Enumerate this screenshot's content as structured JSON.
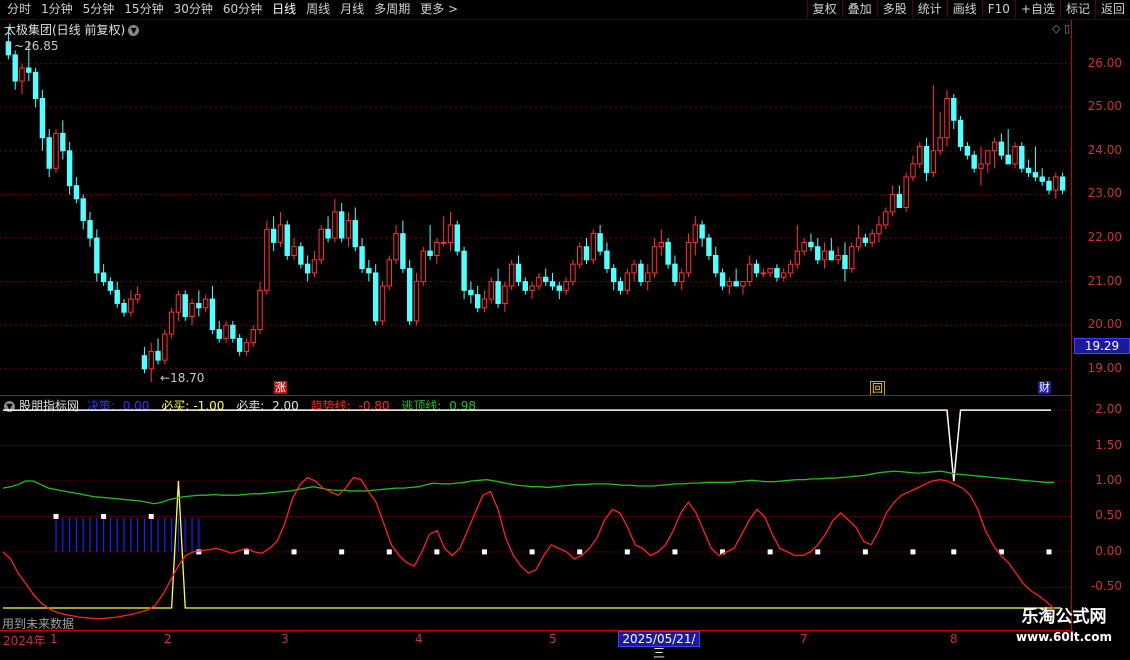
{
  "toolbar": {
    "periods": [
      "分时",
      "1分钟",
      "5分钟",
      "15分钟",
      "30分钟",
      "60分钟",
      "日线",
      "周线",
      "月线",
      "多周期",
      "更多 >"
    ],
    "active_period": "日线",
    "buttons": [
      "复权",
      "叠加",
      "多股",
      "统计",
      "画线",
      "F10",
      "+自选",
      "标记",
      "返回"
    ]
  },
  "stock": {
    "title": "太极集团(日线 前复权)",
    "high_label": "26.85",
    "low_label": "18.70",
    "current_price": "19.29"
  },
  "price_axis": {
    "labels": [
      "26.00",
      "25.00",
      "24.00",
      "23.00",
      "22.00",
      "21.00",
      "20.00",
      "19.00"
    ]
  },
  "markers": {
    "zhang": "涨",
    "hui": "回",
    "cai": "财"
  },
  "indicator": {
    "name": "股朋指标网",
    "juece_label": "决策:",
    "juece_value": "0.00",
    "bimai_label": "必买:",
    "bimai_value": "-1.00",
    "bimaic_label": "必卖:",
    "bimaic_value": "2.00",
    "trend_label": "趋势线:",
    "trend_value": "-0.80",
    "escape_label": "逃顶线:",
    "escape_value": "0.98",
    "axis_labels": [
      "2.00",
      "1.50",
      "1.00",
      "0.50",
      "0.00",
      "-0.50"
    ],
    "future_note": "用到未来数据"
  },
  "xaxis": {
    "year": "2024年",
    "months": [
      "1",
      "2",
      "3",
      "4",
      "5",
      "7",
      "8"
    ],
    "cursor_date": "2025/05/21/三"
  },
  "watermark": {
    "line1": "乐淘公式网",
    "line2": "www.60lt.com"
  },
  "colors": {
    "up": "#ff3232",
    "down": "#54ffff",
    "trend": "#ff2020",
    "escape": "#20c020",
    "white": "#ffffff",
    "yellow": "#ffff40",
    "blue": "#2020ff"
  },
  "chart_data": {
    "type": "candlestick",
    "price_ylim": [
      18.4,
      27.0
    ],
    "candles": [
      [
        26.5,
        26.85,
        26.1,
        26.2
      ],
      [
        26.2,
        26.3,
        25.4,
        25.6
      ],
      [
        25.6,
        26.0,
        25.3,
        25.9
      ],
      [
        25.9,
        26.5,
        25.6,
        25.8
      ],
      [
        25.8,
        25.9,
        25.0,
        25.2
      ],
      [
        25.2,
        25.4,
        24.0,
        24.3
      ],
      [
        24.3,
        24.5,
        23.4,
        23.6
      ],
      [
        23.6,
        24.5,
        23.5,
        24.4
      ],
      [
        24.4,
        24.7,
        23.8,
        24.0
      ],
      [
        24.0,
        24.2,
        23.0,
        23.2
      ],
      [
        23.2,
        23.4,
        22.8,
        22.9
      ],
      [
        22.9,
        23.0,
        22.2,
        22.4
      ],
      [
        22.4,
        22.6,
        21.8,
        22.0
      ],
      [
        22.0,
        22.2,
        21.0,
        21.2
      ],
      [
        21.2,
        21.4,
        20.9,
        21.0
      ],
      [
        21.0,
        21.1,
        20.7,
        20.8
      ],
      [
        20.8,
        21.0,
        20.4,
        20.5
      ],
      [
        20.5,
        20.6,
        20.2,
        20.3
      ],
      [
        20.3,
        20.8,
        20.2,
        20.6
      ],
      [
        20.6,
        20.9,
        20.5,
        20.7
      ],
      [
        19.3,
        19.5,
        18.9,
        19.0
      ],
      [
        19.0,
        19.6,
        18.7,
        19.4
      ],
      [
        19.4,
        19.7,
        19.1,
        19.2
      ],
      [
        19.2,
        19.9,
        19.1,
        19.8
      ],
      [
        19.8,
        20.4,
        19.7,
        20.3
      ],
      [
        20.3,
        20.8,
        20.1,
        20.7
      ],
      [
        20.7,
        20.8,
        20.1,
        20.2
      ],
      [
        20.2,
        20.6,
        20.0,
        20.5
      ],
      [
        20.5,
        20.8,
        20.2,
        20.4
      ],
      [
        20.4,
        20.7,
        20.3,
        20.6
      ],
      [
        20.6,
        20.9,
        19.8,
        19.9
      ],
      [
        19.9,
        20.1,
        19.6,
        19.7
      ],
      [
        19.7,
        20.1,
        19.6,
        20.0
      ],
      [
        20.0,
        20.1,
        19.6,
        19.7
      ],
      [
        19.7,
        19.8,
        19.3,
        19.4
      ],
      [
        19.4,
        19.7,
        19.3,
        19.6
      ],
      [
        19.6,
        20.0,
        19.5,
        19.9
      ],
      [
        19.9,
        21.0,
        19.8,
        20.8
      ],
      [
        20.8,
        22.4,
        20.7,
        22.2
      ],
      [
        22.2,
        22.5,
        21.7,
        21.9
      ],
      [
        21.9,
        22.6,
        21.8,
        22.3
      ],
      [
        22.3,
        22.4,
        21.5,
        21.6
      ],
      [
        21.6,
        22.0,
        21.5,
        21.8
      ],
      [
        21.8,
        21.9,
        21.3,
        21.4
      ],
      [
        21.4,
        21.6,
        21.0,
        21.2
      ],
      [
        21.2,
        21.7,
        21.1,
        21.5
      ],
      [
        21.5,
        22.3,
        21.4,
        22.2
      ],
      [
        22.2,
        22.5,
        21.9,
        22.0
      ],
      [
        22.0,
        22.9,
        21.9,
        22.6
      ],
      [
        22.6,
        22.8,
        21.9,
        22.0
      ],
      [
        22.0,
        22.6,
        21.8,
        22.4
      ],
      [
        22.4,
        22.7,
        21.7,
        21.8
      ],
      [
        21.8,
        22.0,
        21.2,
        21.3
      ],
      [
        21.3,
        21.5,
        21.0,
        21.2
      ],
      [
        21.2,
        21.4,
        20.0,
        20.1
      ],
      [
        20.1,
        21.0,
        20.0,
        20.9
      ],
      [
        20.9,
        21.6,
        20.8,
        21.5
      ],
      [
        21.5,
        22.3,
        21.4,
        22.1
      ],
      [
        22.1,
        22.4,
        21.2,
        21.3
      ],
      [
        21.3,
        21.5,
        20.0,
        20.1
      ],
      [
        20.1,
        21.2,
        20.0,
        21.0
      ],
      [
        21.0,
        21.8,
        20.9,
        21.7
      ],
      [
        21.7,
        22.3,
        21.5,
        21.6
      ],
      [
        21.6,
        22.0,
        21.4,
        21.9
      ],
      [
        21.9,
        22.5,
        21.8,
        21.9
      ],
      [
        21.9,
        22.6,
        21.7,
        22.3
      ],
      [
        22.3,
        22.4,
        21.6,
        21.7
      ],
      [
        21.7,
        21.8,
        20.6,
        20.8
      ],
      [
        20.8,
        21.0,
        20.5,
        20.7
      ],
      [
        20.7,
        20.9,
        20.3,
        20.4
      ],
      [
        20.4,
        20.8,
        20.3,
        20.6
      ],
      [
        20.6,
        21.1,
        20.5,
        21.0
      ],
      [
        21.0,
        21.3,
        20.4,
        20.5
      ],
      [
        20.5,
        21.0,
        20.3,
        20.9
      ],
      [
        20.9,
        21.5,
        20.8,
        21.4
      ],
      [
        21.4,
        21.6,
        20.9,
        21.0
      ],
      [
        21.0,
        21.1,
        20.7,
        20.8
      ],
      [
        20.8,
        21.0,
        20.6,
        20.9
      ],
      [
        20.9,
        21.2,
        20.8,
        21.1
      ],
      [
        21.1,
        21.3,
        20.9,
        21.0
      ],
      [
        21.0,
        21.2,
        20.8,
        20.9
      ],
      [
        20.9,
        21.0,
        20.6,
        20.8
      ],
      [
        20.8,
        21.1,
        20.7,
        21.0
      ],
      [
        21.0,
        21.5,
        20.9,
        21.4
      ],
      [
        21.4,
        21.9,
        21.3,
        21.8
      ],
      [
        21.8,
        22.0,
        21.4,
        21.5
      ],
      [
        21.5,
        22.2,
        21.4,
        22.1
      ],
      [
        22.1,
        22.3,
        21.6,
        21.7
      ],
      [
        21.7,
        21.9,
        21.2,
        21.3
      ],
      [
        21.3,
        21.4,
        20.8,
        21.0
      ],
      [
        21.0,
        21.1,
        20.7,
        20.8
      ],
      [
        20.8,
        21.3,
        20.7,
        21.2
      ],
      [
        21.2,
        21.5,
        21.0,
        21.4
      ],
      [
        21.4,
        21.5,
        20.9,
        21.0
      ],
      [
        21.0,
        21.4,
        20.8,
        21.2
      ],
      [
        21.2,
        22.0,
        21.1,
        21.8
      ],
      [
        21.8,
        22.2,
        21.6,
        21.9
      ],
      [
        21.9,
        22.0,
        21.3,
        21.4
      ],
      [
        21.4,
        21.6,
        20.9,
        21.0
      ],
      [
        21.0,
        21.3,
        20.8,
        21.2
      ],
      [
        21.2,
        22.1,
        21.1,
        21.9
      ],
      [
        21.9,
        22.5,
        21.6,
        22.3
      ],
      [
        22.3,
        22.4,
        21.8,
        22.0
      ],
      [
        22.0,
        22.1,
        21.5,
        21.6
      ],
      [
        21.6,
        21.8,
        21.1,
        21.2
      ],
      [
        21.2,
        21.3,
        20.8,
        20.9
      ],
      [
        20.9,
        21.1,
        20.7,
        21.0
      ],
      [
        21.0,
        21.3,
        20.9,
        20.9
      ],
      [
        20.9,
        21.0,
        20.7,
        21.0
      ],
      [
        21.0,
        21.6,
        20.9,
        21.4
      ],
      [
        21.4,
        21.5,
        21.1,
        21.2
      ],
      [
        21.2,
        21.3,
        21.1,
        21.2
      ],
      [
        21.2,
        21.3,
        21.1,
        21.3
      ],
      [
        21.3,
        21.4,
        21.0,
        21.1
      ],
      [
        21.1,
        21.3,
        21.0,
        21.2
      ],
      [
        21.2,
        21.5,
        21.1,
        21.4
      ],
      [
        21.4,
        22.3,
        21.3,
        21.7
      ],
      [
        21.7,
        22.0,
        21.6,
        21.9
      ],
      [
        21.9,
        22.1,
        21.7,
        21.8
      ],
      [
        21.8,
        22.0,
        21.4,
        21.5
      ],
      [
        21.5,
        21.9,
        21.3,
        21.7
      ],
      [
        21.7,
        22.0,
        21.5,
        21.5
      ],
      [
        21.5,
        21.8,
        21.4,
        21.6
      ],
      [
        21.6,
        21.9,
        21.0,
        21.3
      ],
      [
        21.3,
        21.9,
        21.2,
        21.8
      ],
      [
        21.8,
        22.3,
        21.7,
        22.0
      ],
      [
        22.0,
        22.1,
        21.8,
        21.9
      ],
      [
        21.9,
        22.2,
        21.8,
        22.1
      ],
      [
        22.1,
        22.5,
        21.9,
        22.3
      ],
      [
        22.3,
        22.7,
        22.2,
        22.6
      ],
      [
        22.6,
        23.2,
        22.5,
        23.0
      ],
      [
        23.0,
        23.2,
        22.8,
        22.7
      ],
      [
        22.7,
        23.5,
        22.6,
        23.4
      ],
      [
        23.4,
        23.9,
        23.3,
        23.7
      ],
      [
        23.7,
        24.2,
        23.6,
        24.1
      ],
      [
        24.1,
        24.3,
        23.3,
        23.5
      ],
      [
        23.5,
        25.5,
        23.4,
        24.0
      ],
      [
        24.0,
        24.9,
        23.9,
        24.3
      ],
      [
        24.3,
        25.4,
        24.1,
        25.2
      ],
      [
        25.2,
        25.3,
        24.5,
        24.7
      ],
      [
        24.7,
        24.8,
        24.0,
        24.1
      ],
      [
        24.1,
        24.2,
        23.8,
        23.9
      ],
      [
        23.9,
        24.0,
        23.5,
        23.6
      ],
      [
        23.6,
        24.1,
        23.2,
        23.7
      ],
      [
        23.7,
        24.0,
        23.5,
        24.0
      ],
      [
        24.0,
        24.3,
        23.6,
        24.2
      ],
      [
        24.2,
        24.4,
        23.8,
        23.9
      ],
      [
        23.9,
        24.5,
        23.7,
        23.7
      ],
      [
        23.7,
        24.2,
        23.6,
        24.1
      ],
      [
        24.1,
        24.2,
        23.5,
        23.6
      ],
      [
        23.6,
        23.8,
        23.4,
        23.5
      ],
      [
        23.5,
        24.1,
        23.3,
        23.4
      ],
      [
        23.4,
        23.6,
        23.2,
        23.3
      ],
      [
        23.3,
        23.4,
        23.0,
        23.1
      ],
      [
        23.1,
        23.5,
        22.9,
        23.4
      ],
      [
        23.4,
        23.5,
        23.0,
        23.1
      ]
    ],
    "indicator_ylim": [
      -0.82,
      2.2
    ],
    "white_line": {
      "from": 0,
      "to": 1.5,
      "values": "2.00 constant with dip to 1.00 near index 139"
    },
    "trend_line": [
      -0.0,
      -0.1,
      -0.3,
      -0.45,
      -0.6,
      -0.72,
      -0.8,
      -0.85,
      -0.88,
      -0.9,
      -0.92,
      -0.93,
      -0.94,
      -0.94,
      -0.93,
      -0.92,
      -0.9,
      -0.88,
      -0.85,
      -0.82,
      -0.75,
      -0.6,
      -0.4,
      -0.2,
      -0.05,
      0.0,
      0.02,
      0.03,
      0.05,
      0.02,
      -0.02,
      0.02,
      0.05,
      0.0,
      -0.02,
      0.05,
      0.15,
      0.4,
      0.75,
      0.95,
      1.05,
      1.0,
      0.9,
      0.85,
      0.8,
      0.9,
      1.05,
      1.02,
      0.85,
      0.7,
      0.4,
      0.1,
      -0.05,
      -0.15,
      -0.2,
      0.0,
      0.25,
      0.3,
      0.05,
      -0.05,
      0.05,
      0.3,
      0.55,
      0.8,
      0.85,
      0.6,
      0.2,
      -0.05,
      -0.2,
      -0.3,
      -0.25,
      -0.05,
      0.1,
      0.05,
      0.0,
      -0.1,
      -0.05,
      0.05,
      0.2,
      0.45,
      0.6,
      0.55,
      0.35,
      0.1,
      0.05,
      -0.05,
      0.0,
      0.1,
      0.3,
      0.55,
      0.7,
      0.55,
      0.3,
      0.05,
      -0.05,
      0.0,
      0.05,
      0.25,
      0.45,
      0.6,
      0.5,
      0.25,
      0.05,
      0.0,
      -0.05,
      -0.05,
      0.0,
      0.1,
      0.25,
      0.45,
      0.55,
      0.45,
      0.35,
      0.15,
      0.1,
      0.3,
      0.55,
      0.7,
      0.8,
      0.85,
      0.9,
      0.95,
      1.0,
      1.02,
      1.0,
      0.95,
      0.9,
      0.8,
      0.6,
      0.3,
      0.1,
      -0.05,
      -0.15,
      -0.3,
      -0.45,
      -0.55,
      -0.62,
      -0.7,
      -0.8
    ],
    "escape_line": [
      0.9,
      0.92,
      0.95,
      1.0,
      1.0,
      0.95,
      0.9,
      0.88,
      0.86,
      0.84,
      0.82,
      0.8,
      0.78,
      0.77,
      0.76,
      0.75,
      0.74,
      0.73,
      0.72,
      0.7,
      0.68,
      0.7,
      0.74,
      0.76,
      0.78,
      0.79,
      0.8,
      0.8,
      0.81,
      0.8,
      0.8,
      0.8,
      0.81,
      0.82,
      0.82,
      0.83,
      0.84,
      0.85,
      0.86,
      0.88,
      0.9,
      0.92,
      0.9,
      0.88,
      0.87,
      0.87,
      0.86,
      0.86,
      0.86,
      0.87,
      0.88,
      0.89,
      0.9,
      0.9,
      0.91,
      0.92,
      0.95,
      0.97,
      0.96,
      0.96,
      0.97,
      0.98,
      1.0,
      1.01,
      1.02,
      1.0,
      0.98,
      0.96,
      0.94,
      0.93,
      0.92,
      0.92,
      0.91,
      0.92,
      0.93,
      0.94,
      0.95,
      0.95,
      0.96,
      0.96,
      0.96,
      0.95,
      0.94,
      0.94,
      0.93,
      0.93,
      0.93,
      0.94,
      0.95,
      0.96,
      0.96,
      0.97,
      0.97,
      0.98,
      0.98,
      0.98,
      0.98,
      0.99,
      1.0,
      1.01,
      1.0,
      0.99,
      0.99,
      1.0,
      1.01,
      1.02,
      1.02,
      1.03,
      1.03,
      1.04,
      1.04,
      1.05,
      1.06,
      1.07,
      1.08,
      1.1,
      1.12,
      1.13,
      1.14,
      1.13,
      1.12,
      1.11,
      1.12,
      1.13,
      1.14,
      1.12,
      1.1,
      1.09,
      1.08,
      1.07,
      1.06,
      1.05,
      1.04,
      1.03,
      1.02,
      1.01,
      1.0,
      0.99,
      0.98,
      0.98
    ]
  }
}
